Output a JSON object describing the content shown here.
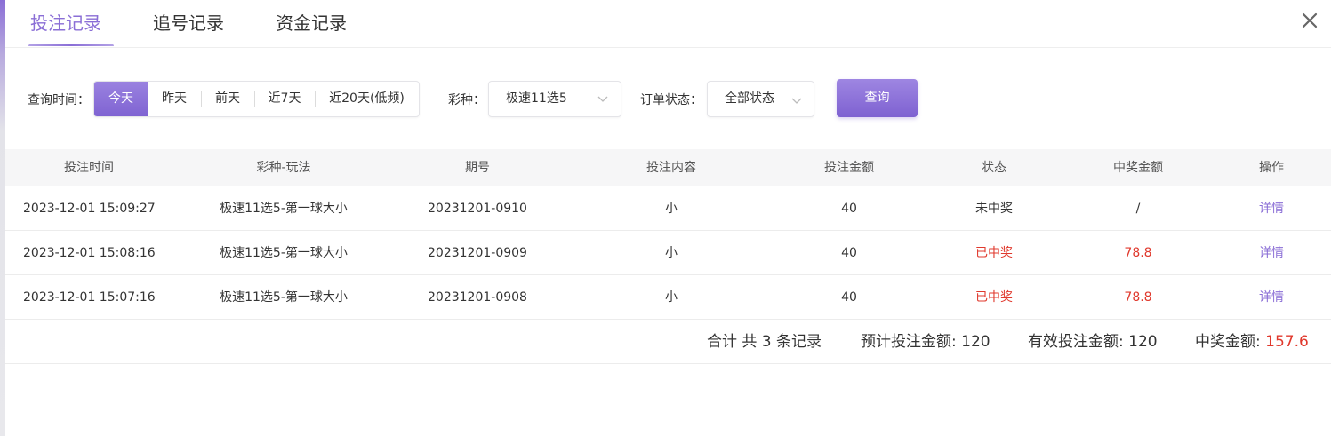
{
  "tabs": [
    {
      "label": "投注记录",
      "active": true
    },
    {
      "label": "追号记录",
      "active": false
    },
    {
      "label": "资金记录",
      "active": false
    }
  ],
  "filters": {
    "time_label": "查询时间：",
    "time_options": [
      "今天",
      "昨天",
      "前天",
      "近7天",
      "近20天(低频)"
    ],
    "time_selected": "今天",
    "lottery_label": "彩种：",
    "lottery_value": "极速11选5",
    "status_label": "订单状态：",
    "status_value": "全部状态",
    "query_button": "查询"
  },
  "table": {
    "headers": [
      "投注时间",
      "彩种-玩法",
      "期号",
      "投注内容",
      "投注金额",
      "状态",
      "中奖金额",
      "操作"
    ],
    "rows": [
      {
        "time": "2023-12-01 15:09:27",
        "game": "极速11选5-第一球大小",
        "issue": "20231201-0910",
        "content": "小",
        "amount": "40",
        "status": "未中奖",
        "win": "/",
        "action": "详情",
        "won": false
      },
      {
        "time": "2023-12-01 15:08:16",
        "game": "极速11选5-第一球大小",
        "issue": "20231201-0909",
        "content": "小",
        "amount": "40",
        "status": "已中奖",
        "win": "78.8",
        "action": "详情",
        "won": true
      },
      {
        "time": "2023-12-01 15:07:16",
        "game": "极速11选5-第一球大小",
        "issue": "20231201-0908",
        "content": "小",
        "amount": "40",
        "status": "已中奖",
        "win": "78.8",
        "action": "详情",
        "won": true
      }
    ]
  },
  "summary": {
    "total": "合计 共 3 条记录",
    "expected_label": "预计投注金额:",
    "expected_value": "120",
    "valid_label": "有效投注金额:",
    "valid_value": "120",
    "win_label": "中奖金额:",
    "win_value": "157.6"
  },
  "colors": {
    "accent": "#8a6ed6",
    "win_red": "#e0392d"
  }
}
